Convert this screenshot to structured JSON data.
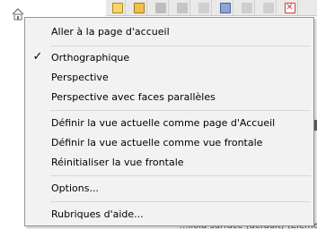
{
  "menu": {
    "items": [
      {
        "label": "Aller à la page d'accueil",
        "checked": false
      },
      {
        "label": "Orthographique",
        "checked": true
      },
      {
        "label": "Perspective",
        "checked": false
      },
      {
        "label": "Perspective avec faces parallèles",
        "checked": false
      },
      {
        "label": "Définir la vue actuelle comme page d'Accueil",
        "checked": false
      },
      {
        "label": "Définir la vue actuelle comme vue frontale",
        "checked": false
      },
      {
        "label": "Réinitialiser la vue frontale",
        "checked": false
      },
      {
        "label": "Options...",
        "checked": false
      },
      {
        "label": "Rubriques d'aide...",
        "checked": false
      }
    ],
    "check_glyph": "✓"
  },
  "toolbar": {
    "icons": [
      {
        "name": "new-sheet-icon",
        "color": "#f4c542"
      },
      {
        "name": "open-folder-icon",
        "color": "#e8b339"
      },
      {
        "name": "tool-icon",
        "color": "#9a9a9a"
      },
      {
        "name": "pen-icon",
        "color": "#9a9a9a"
      },
      {
        "name": "disabled-tool-icon",
        "color": "#b0b0b0"
      },
      {
        "name": "properties-icon",
        "color": "#6a7fb5"
      },
      {
        "name": "move-up-icon",
        "color": "#a0a0a0"
      },
      {
        "name": "move-down-icon",
        "color": "#a0a0a0"
      },
      {
        "name": "delete-icon",
        "color": "#d33a3a"
      }
    ]
  },
  "background": {
    "partial_text": "...lloid surface (default) (Élément"
  },
  "colors": {
    "menu_bg": "#f2f2f2",
    "menu_border": "#979797"
  }
}
